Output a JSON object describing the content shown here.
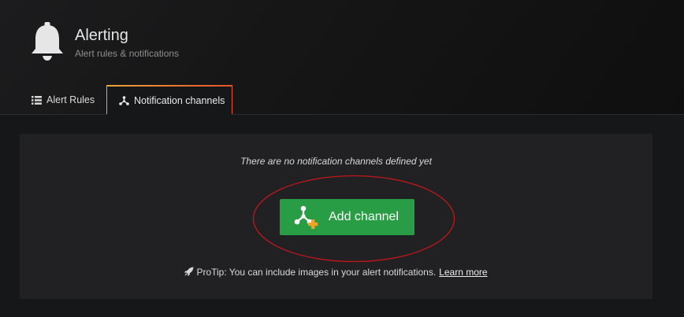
{
  "header": {
    "title": "Alerting",
    "subtitle": "Alert rules & notifications",
    "icon": "bell-icon"
  },
  "tabs": [
    {
      "label": "Alert Rules",
      "icon": "list-icon",
      "active": false
    },
    {
      "label": "Notification channels",
      "icon": "channels-icon",
      "active": true
    }
  ],
  "empty_state": {
    "message": "There are no notification channels defined yet",
    "button_label": "Add channel",
    "button_icon": "add-channel-icon",
    "protip_text": "ProTip: You can include images in your alert notifications.",
    "protip_link": "Learn more",
    "protip_icon": "rocket-icon"
  },
  "colors": {
    "accent_green": "#299c46",
    "tab_gradient_start": "#f0a33a",
    "tab_gradient_end": "#e5532b",
    "annotation_red": "#c0171b"
  }
}
